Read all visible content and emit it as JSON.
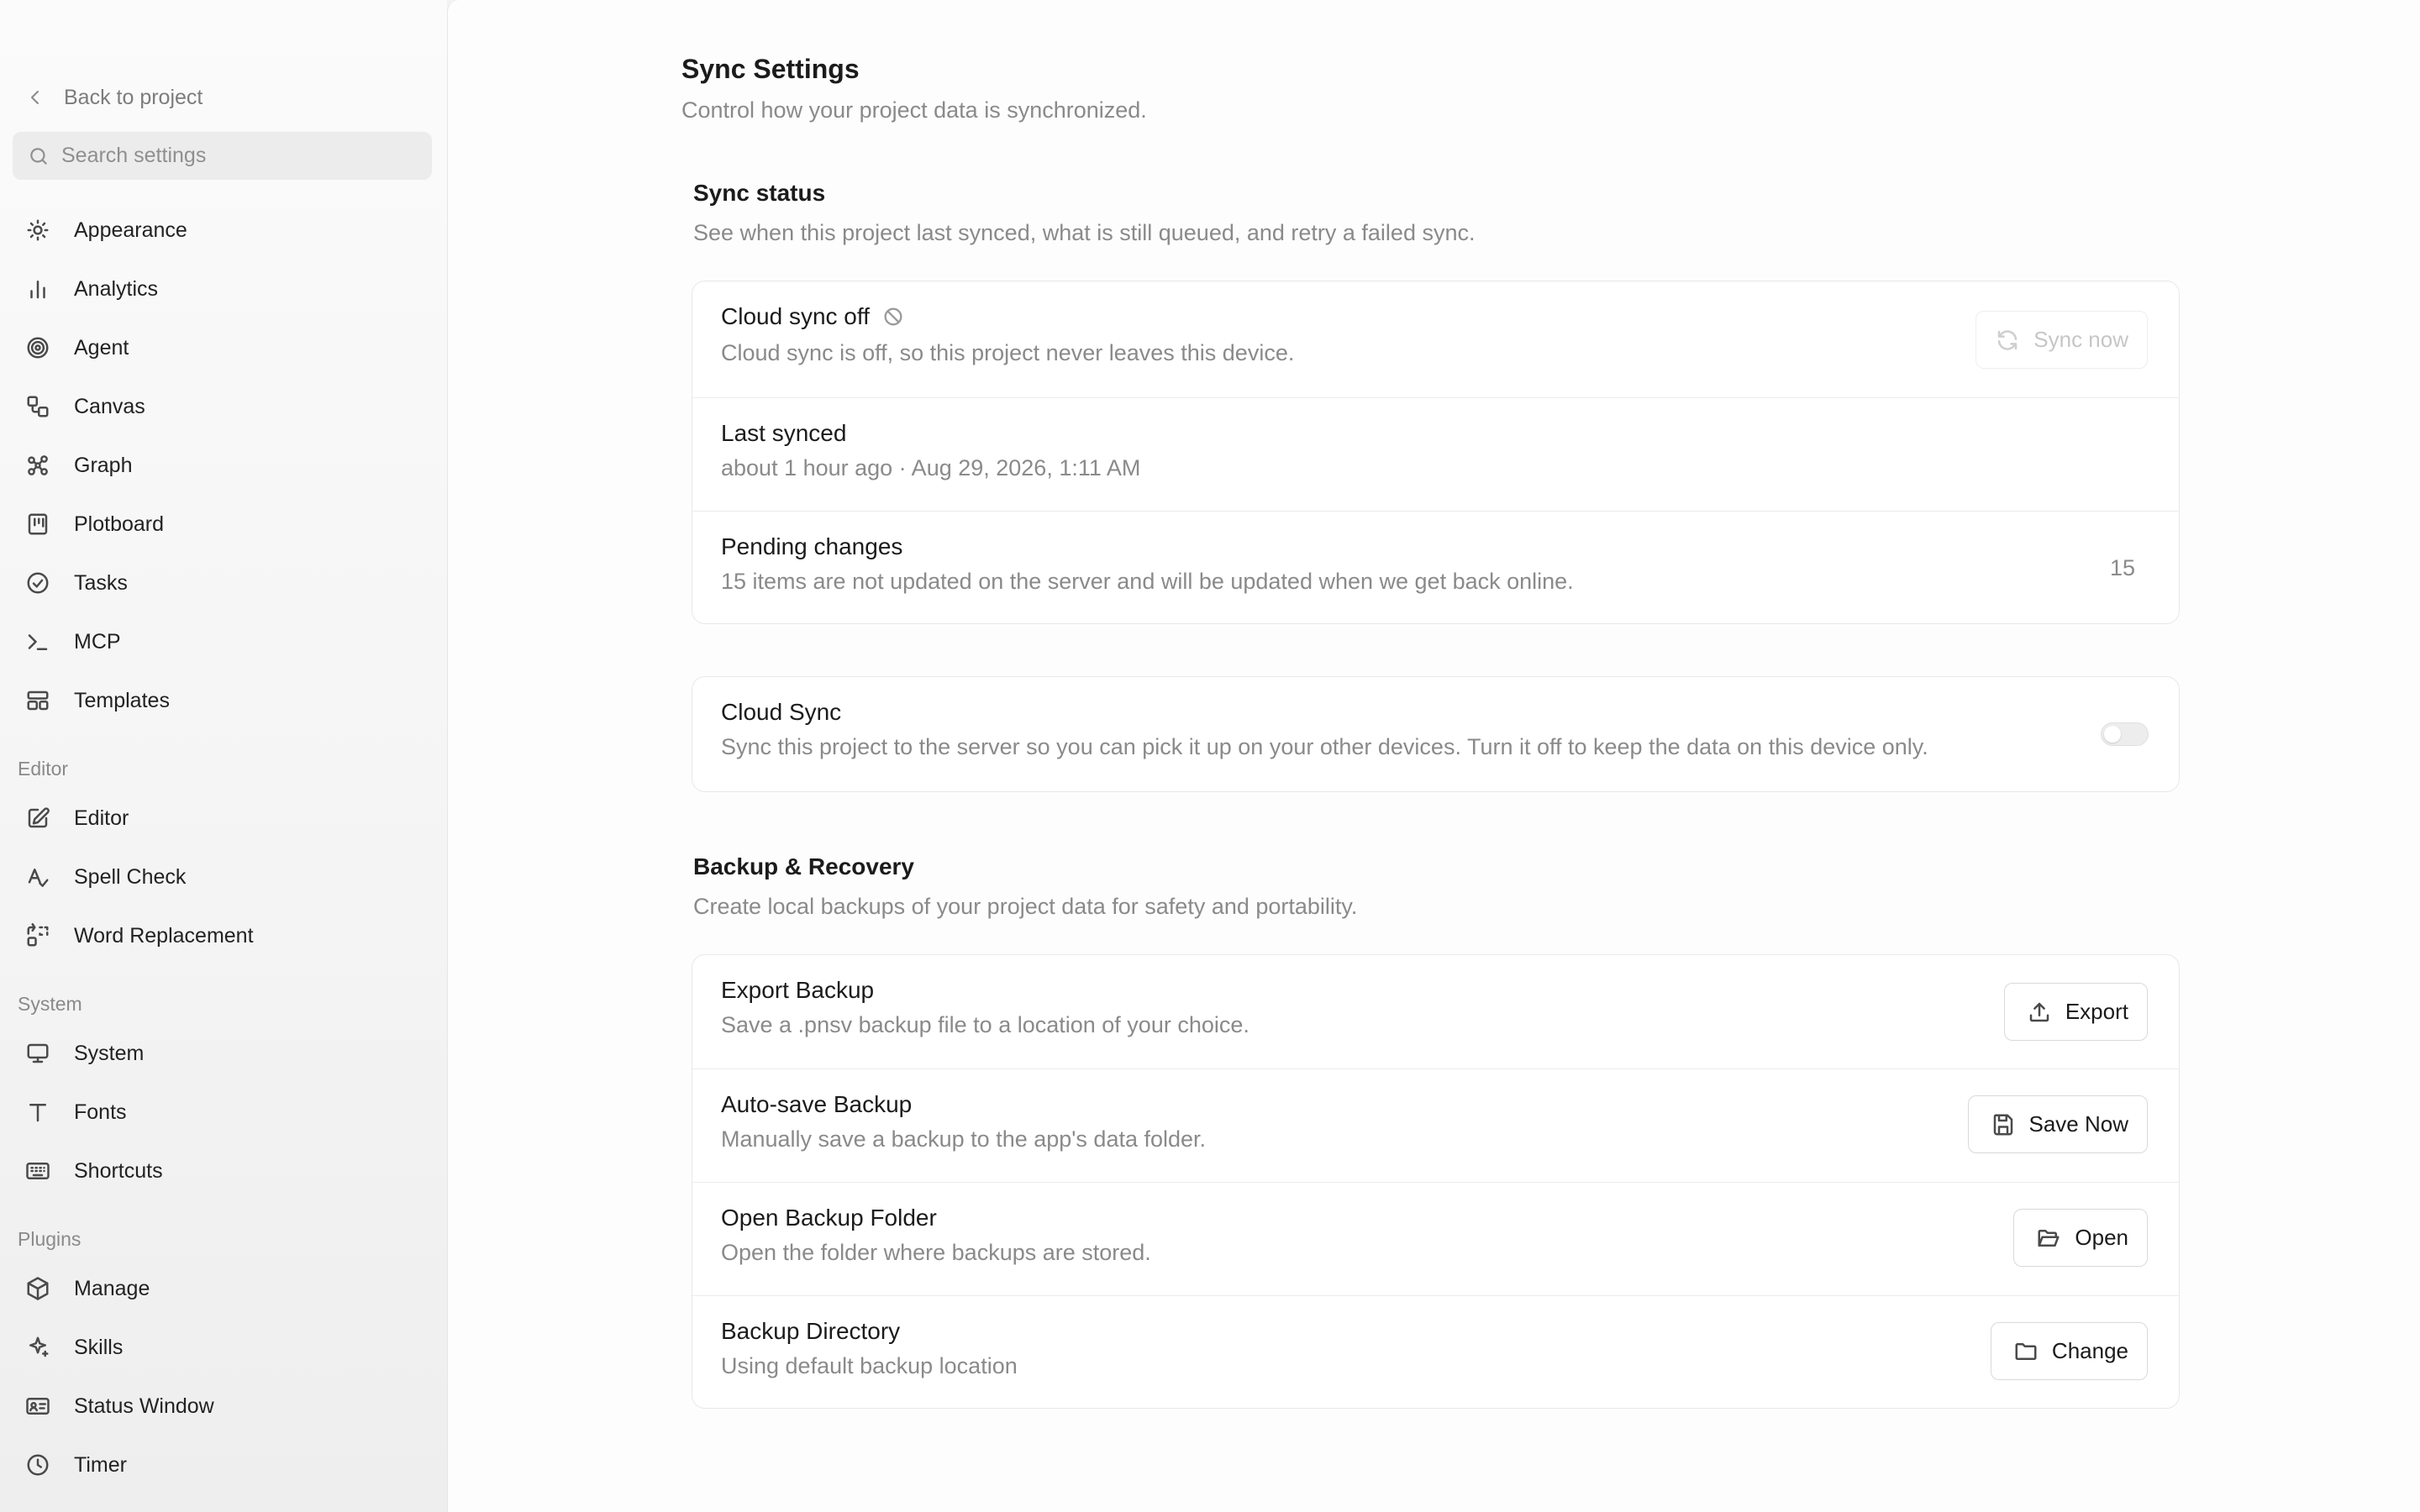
{
  "sidebar": {
    "back_label": "Back to project",
    "search_placeholder": "Search settings",
    "items": [
      {
        "label": "Appearance",
        "icon": "sun-icon"
      },
      {
        "label": "Analytics",
        "icon": "bar-chart-icon"
      },
      {
        "label": "Agent",
        "icon": "spiral-icon"
      },
      {
        "label": "Canvas",
        "icon": "shapes-icon"
      },
      {
        "label": "Graph",
        "icon": "graph-icon"
      },
      {
        "label": "Plotboard",
        "icon": "board-icon"
      },
      {
        "label": "Tasks",
        "icon": "check-circle-icon"
      },
      {
        "label": "MCP",
        "icon": "terminal-icon"
      },
      {
        "label": "Templates",
        "icon": "layout-icon"
      }
    ],
    "sections": [
      {
        "label": "Editor",
        "items": [
          {
            "label": "Editor",
            "icon": "edit-icon"
          },
          {
            "label": "Spell Check",
            "icon": "spell-check-icon"
          },
          {
            "label": "Word Replacement",
            "icon": "replace-icon"
          }
        ]
      },
      {
        "label": "System",
        "items": [
          {
            "label": "System",
            "icon": "monitor-icon"
          },
          {
            "label": "Fonts",
            "icon": "type-icon"
          },
          {
            "label": "Shortcuts",
            "icon": "keyboard-icon"
          }
        ]
      },
      {
        "label": "Plugins",
        "items": [
          {
            "label": "Manage",
            "icon": "package-icon"
          },
          {
            "label": "Skills",
            "icon": "sparkle-icon"
          },
          {
            "label": "Status Window",
            "icon": "id-card-icon"
          },
          {
            "label": "Timer",
            "icon": "clock-icon"
          }
        ]
      }
    ]
  },
  "main": {
    "title": "Sync Settings",
    "subtitle": "Control how your project data is synchronized.",
    "sync_status": {
      "title": "Sync status",
      "subtitle": "See when this project last synced, what is still queued, and retry a failed sync.",
      "cloud_off_title": "Cloud sync off",
      "cloud_off_desc": "Cloud sync is off, so this project never leaves this device.",
      "sync_now_label": "Sync now",
      "last_synced_title": "Last synced",
      "last_synced_value": "about 1 hour ago · Aug 29, 2026, 1:11 AM",
      "pending_title": "Pending changes",
      "pending_desc": "15 items are not updated on the server and will be updated when we get back online.",
      "pending_count": "15"
    },
    "cloud_sync": {
      "title": "Cloud Sync",
      "desc": "Sync this project to the server so you can pick it up on your other devices. Turn it off to keep the data on this device only.",
      "enabled": false
    },
    "backup": {
      "title": "Backup & Recovery",
      "subtitle": "Create local backups of your project data for safety and portability.",
      "rows": [
        {
          "title": "Export Backup",
          "desc": "Save a .pnsv backup file to a location of your choice.",
          "button": "Export",
          "icon": "upload-icon"
        },
        {
          "title": "Auto-save Backup",
          "desc": "Manually save a backup to the app's data folder.",
          "button": "Save Now",
          "icon": "save-icon"
        },
        {
          "title": "Open Backup Folder",
          "desc": "Open the folder where backups are stored.",
          "button": "Open",
          "icon": "folder-open-icon"
        },
        {
          "title": "Backup Directory",
          "desc": "Using default backup location",
          "button": "Change",
          "icon": "folder-icon"
        }
      ]
    }
  },
  "colors": {
    "sidebar_bg": "#f6f6f6",
    "main_bg": "#fdfdfd",
    "muted_text": "#8a8a8a",
    "border": "#e8e8e8"
  }
}
